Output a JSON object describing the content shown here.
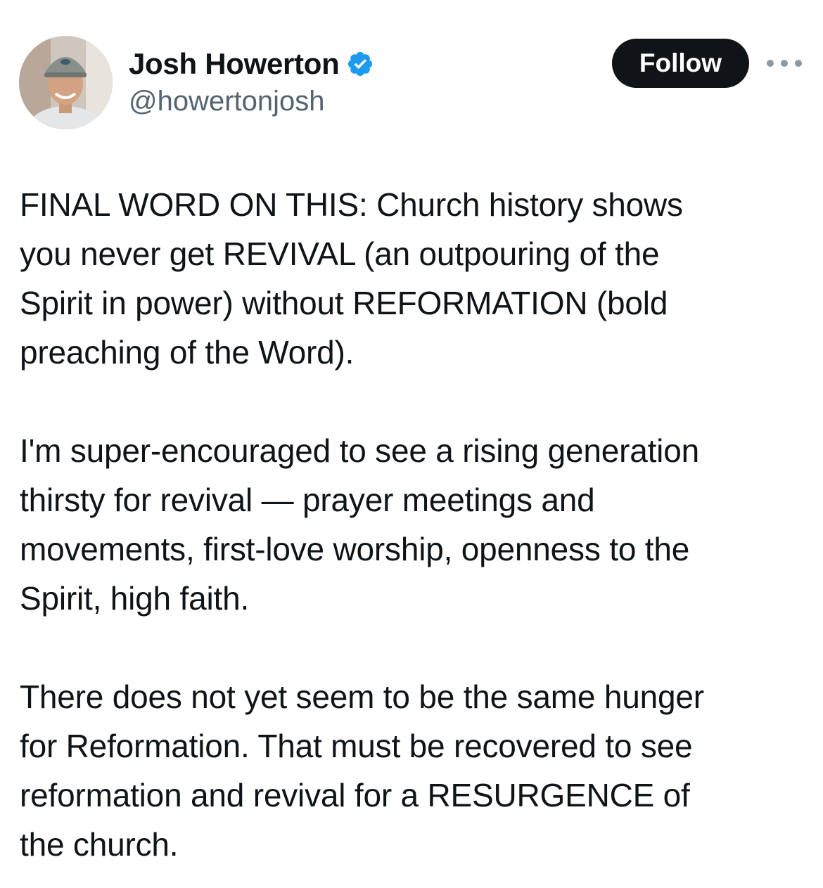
{
  "author": {
    "display_name": "Josh Howerton",
    "handle": "@howertonjosh",
    "verified": true,
    "verified_color": "#1d9bf0"
  },
  "actions": {
    "follow_label": "Follow",
    "more_icon": "more-horizontal-icon"
  },
  "tweet": {
    "paragraphs": [
      "FINAL WORD ON THIS: Church history shows\nyou never get REVIVAL (an outpouring of the\nSpirit in power) without REFORMATION (bold\npreaching of the Word).",
      "I'm super-encouraged to see a rising generation\nthirsty for revival — prayer meetings and\nmovements, first-love worship, openness to the\nSpirit, high faith.",
      "There does not yet seem to be the same hunger\nfor Reformation. That must be recovered to see\nreformation and revival for a RESURGENCE of\nthe church."
    ]
  },
  "colors": {
    "text_primary": "#0f1419",
    "text_secondary": "#536471",
    "follow_bg": "#0f1419",
    "follow_text": "#ffffff"
  }
}
